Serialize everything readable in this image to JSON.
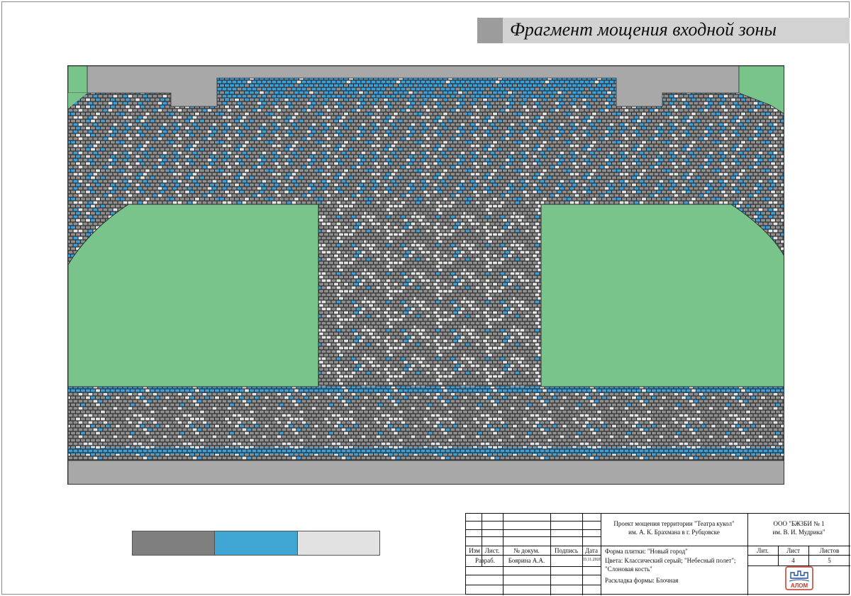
{
  "title": "Фрагмент мощения входной зоны",
  "colors": {
    "grass": "#78c48a",
    "concrete": "#a8a8a8",
    "tile_gray": "#8f8f8f",
    "tile_blue": "#3aa0dc",
    "tile_ivory": "#e6e6e6",
    "joint": "#2d2d2d",
    "swatch_gray": "#7f7f7f",
    "swatch_blue": "#3fa6d4",
    "swatch_ivory": "#e2e2e2"
  },
  "swatches": [
    {
      "name": "Классический серый",
      "color": "#7f7f7f"
    },
    {
      "name": "Небесный полет",
      "color": "#3fa6d4"
    },
    {
      "name": "Слоновая кость",
      "color": "#e2e2e2"
    }
  ],
  "stamp": {
    "project_line1": "Проект мощения территории \"Театра кукол\"",
    "project_line2": "им. А. К. Брахмана в г. Рубцовске",
    "org_line1": "ООО \"БЖЗБИ № 1",
    "org_line2": "им. В. И. Мудрика\"",
    "headers": {
      "izm": "Изм",
      "list": "Лист.",
      "doc": "№ докум.",
      "sign": "Подпись",
      "date": "Дата"
    },
    "dev_role": "Разраб.",
    "dev_name": "Боярина А.А.",
    "dev_date": "03.11.2020",
    "info_line1": "Форма плитки: \"Новый город\"",
    "info_line2": "Цвета: Классический серый; \"Небесный полет\";",
    "info_line3": "\"Слоновая кость\"",
    "info_line4": "Раскладка формы: Блочная",
    "lit_label": "Лит.",
    "sheet_label": "Лист",
    "sheets_label": "Листов",
    "sheet_value": "4",
    "sheets_value": "5",
    "logo_text": "АЛОМ"
  }
}
